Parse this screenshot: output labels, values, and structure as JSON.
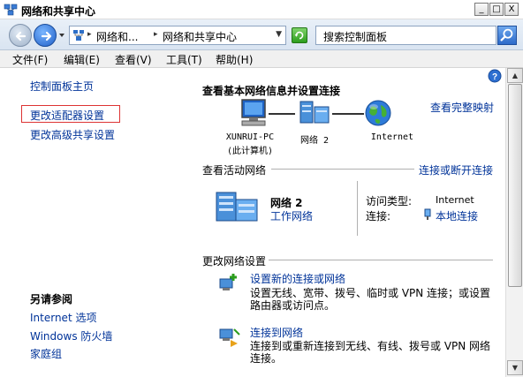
{
  "window": {
    "title": "网络和共享中心",
    "controls": {
      "minimize": "_",
      "maximize": "□",
      "close": "X"
    }
  },
  "address_bar": {
    "crumbs": [
      "网络和...",
      "网络和共享中心"
    ],
    "search_placeholder": "搜索控制面板"
  },
  "menu": [
    "文件(F)",
    "编辑(E)",
    "查看(V)",
    "工具(T)",
    "帮助(H)"
  ],
  "sidebar": {
    "items": [
      "控制面板主页",
      "更改适配器设置",
      "更改高级共享设置"
    ],
    "see_also_title": "另请参阅",
    "see_also": [
      "Internet 选项",
      "Windows 防火墙",
      "家庭组"
    ]
  },
  "main": {
    "heading": "查看基本网络信息并设置连接",
    "view_full_map": "查看完整映射",
    "diagram": {
      "computer_name": "XUNRUI-PC",
      "computer_sub": "(此计算机)",
      "network_name": "网络  2",
      "internet": "Internet"
    },
    "active_networks_heading": "查看活动网络",
    "connect_disconnect": "连接或断开连接",
    "active_network": {
      "name": "网络  2",
      "type": "工作网络",
      "access_type_label": "访问类型:",
      "access_type_value": "Internet",
      "connection_label": "连接:",
      "connection_value": "本地连接"
    },
    "change_settings_heading": "更改网络设置",
    "tasks": [
      {
        "title": "设置新的连接或网络",
        "desc_lines": [
          "设置无线、宽带、拨号、临时或 VPN 连接；或设置",
          "路由器或访问点。"
        ]
      },
      {
        "title": "连接到网络",
        "desc_lines": [
          "连接到或重新连接到无线、有线、拨号或 VPN 网络",
          "连接。"
        ]
      }
    ]
  },
  "colors": {
    "link": "#003399",
    "selection_border": "#dd3333",
    "address_bar_bg": "#e2eaf5"
  }
}
